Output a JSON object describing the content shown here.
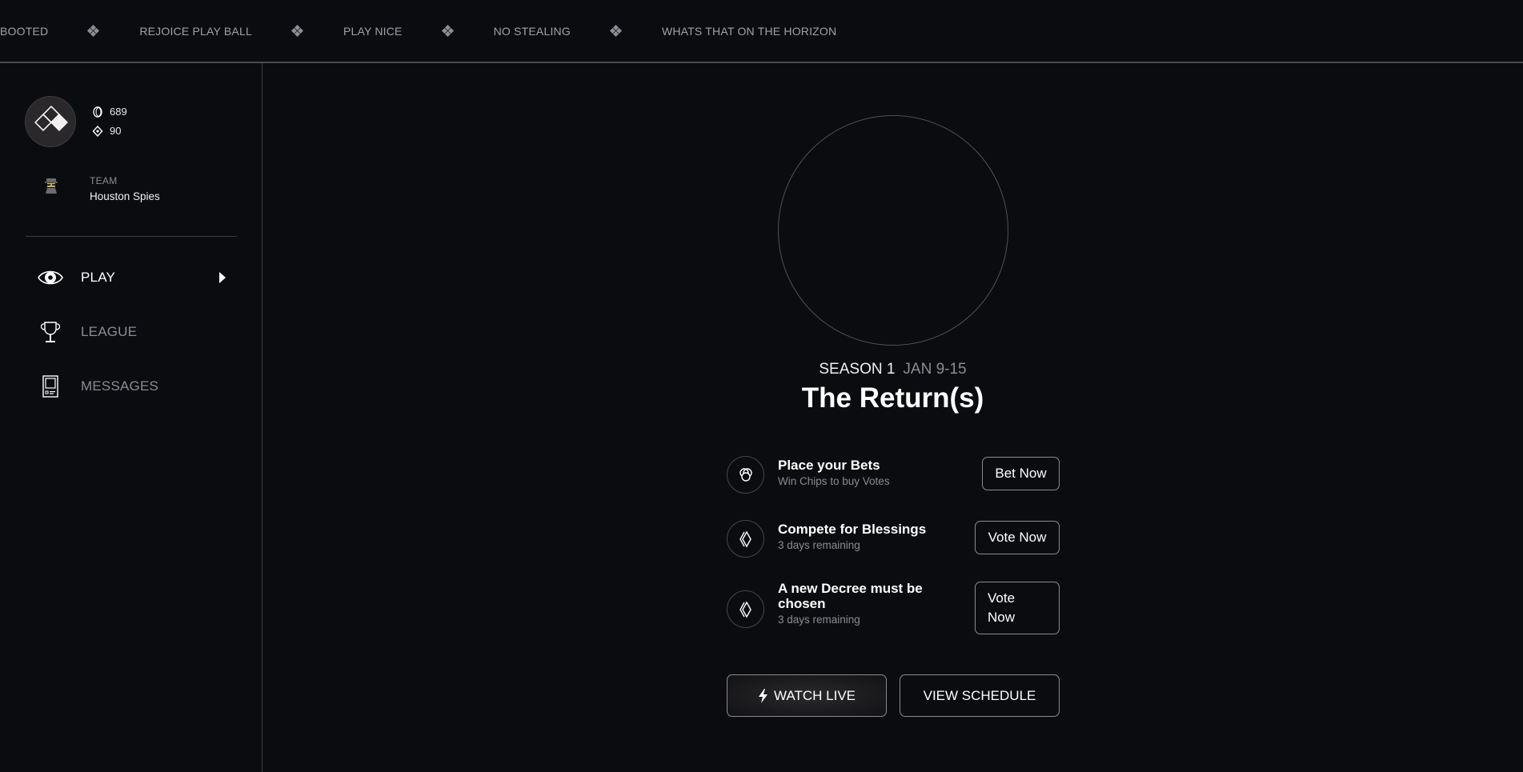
{
  "ticker": {
    "items": [
      "BOOTED",
      "REJOICE PLAY BALL",
      "PLAY NICE",
      "NO STEALING",
      "WHATS THAT ON THE HORIZON"
    ],
    "separator_icon": "four-diamond-icon"
  },
  "sidebar": {
    "profile": {
      "avatar_icon": "diamonds-logo-icon",
      "coins": "689",
      "coins_icon": "coin-icon",
      "votes": "90",
      "votes_icon": "diamond-vote-icon"
    },
    "team": {
      "label": "TEAM",
      "name": "Houston Spies",
      "icon": "spy-emoji-icon"
    },
    "nav": [
      {
        "label": "PLAY",
        "icon": "eye-icon",
        "active": true
      },
      {
        "label": "LEAGUE",
        "icon": "trophy-icon",
        "active": false
      },
      {
        "label": "MESSAGES",
        "icon": "book-icon",
        "active": false
      }
    ]
  },
  "main": {
    "season_label": "SEASON 1",
    "season_dates": "JAN 9-15",
    "title": "The Return(s)",
    "actions": [
      {
        "title": "Place your Bets",
        "subtitle": "Win Chips to buy Votes",
        "button": "Bet Now",
        "icon": "chips-icon"
      },
      {
        "title": "Compete for Blessings",
        "subtitle": "3 days remaining",
        "button": "Vote Now",
        "icon": "blessing-diamond-icon"
      },
      {
        "title": "A new Decree must be chosen",
        "subtitle": "3 days remaining",
        "button": "Vote Now",
        "icon": "decree-diamond-icon"
      }
    ],
    "watch_live": "WATCH LIVE",
    "view_schedule": "VIEW SCHEDULE"
  },
  "colors": {
    "background": "#0b0c0f",
    "muted_text": "#8b8c93",
    "border": "#8a8b91"
  }
}
